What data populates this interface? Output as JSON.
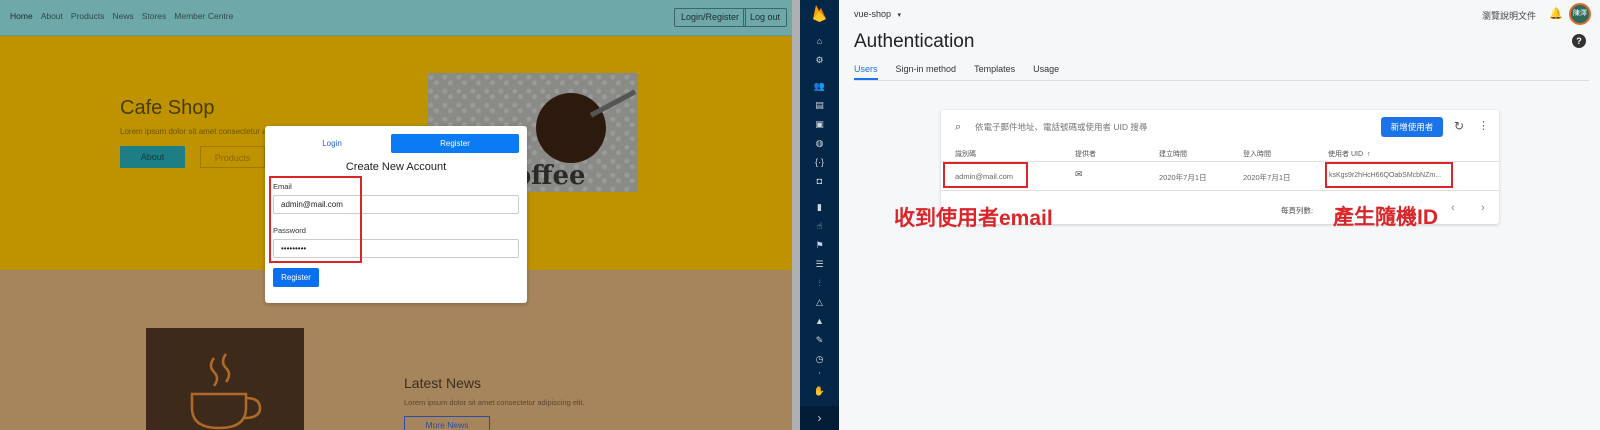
{
  "cafe_site": {
    "nav_links": [
      "Home",
      "About",
      "Products",
      "News",
      "Stores",
      "Member Centre"
    ],
    "login_register_label": "Login/Register",
    "logout_label": "Log out",
    "hero_title": "Cafe Shop",
    "hero_text": "Lorem ipsum dolor sit amet consectetur ad",
    "about_button": "About",
    "products_button": "Products",
    "coffee_word": "coffee",
    "news_title": "Latest News",
    "news_text": "Lorem ipsum dolor sit amet consectetur adipiscing elit.",
    "news_button": "More News"
  },
  "modal": {
    "tab_login": "Login",
    "tab_register": "Register",
    "title": "Create New Account",
    "email_label": "Email",
    "email_value": "admin@mail.com",
    "password_label": "Password",
    "password_value": "•••••••••",
    "register_button": "Register"
  },
  "firebase_nav": {
    "icons": [
      "home-icon",
      "gear-icon",
      "users-icon",
      "database-icon",
      "storage-icon",
      "hosting-icon",
      "functions-icon",
      "ml-icon",
      "analytics-icon",
      "predictions-icon",
      "flag-icon",
      "user-list-icon",
      "funnel-icon",
      "shapes-icon",
      "rocket-icon",
      "dev-icon",
      "clock-icon",
      "extension-icon",
      "puzzle-icon"
    ],
    "expand_glyph": "›"
  },
  "console": {
    "project": "vue-shop",
    "project_caret": "▾",
    "docs_link": "瀏覽說明文件",
    "avatar_text": "陳澤",
    "page_title": "Authentication",
    "help": "?",
    "tabs": [
      "Users",
      "Sign-in method",
      "Templates",
      "Usage"
    ],
    "search_placeholder": "依電子郵件地址、電話號碼或使用者 UID 搜尋",
    "add_user_button": "新增使用者",
    "headers": {
      "identifier": "識別碼",
      "provider": "提供者",
      "created": "建立時間",
      "signed_in": "登入時間",
      "uid": "使用者 UID"
    },
    "sort_arrow": "↑",
    "row": {
      "identifier": "admin@mail.com",
      "created": "2020年7月1日",
      "signed_in": "2020年7月1日",
      "uid": "ksKgs9r2hHcH66QOabSMcbNZm..."
    },
    "rows_per_page_label": "每頁列數:",
    "annotation_email": "收到使用者email",
    "annotation_uid": "產生隨機ID"
  },
  "colors": {
    "highlight_red": "#d9262a",
    "firebase_navy": "#052747",
    "console_blue": "#1a73e8",
    "register_blue": "#0b7af5"
  }
}
